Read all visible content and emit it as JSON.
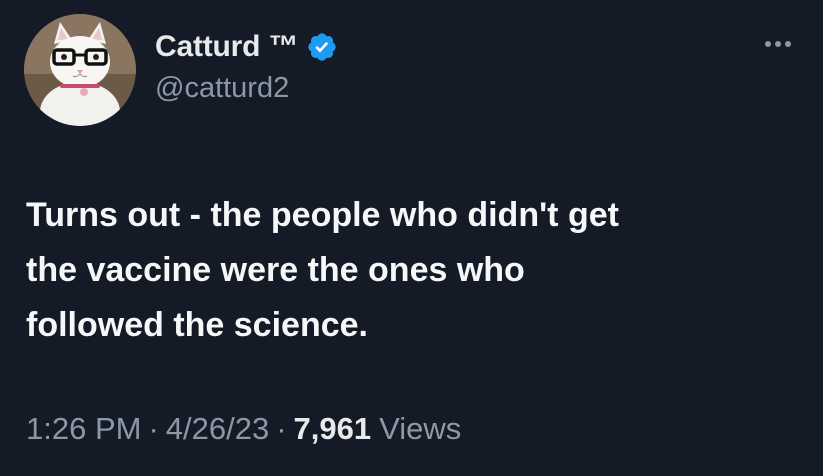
{
  "author": {
    "display_name": "Catturd ™",
    "handle": "@catturd2",
    "avatar_icon": "cat-with-glasses-avatar",
    "verified_icon": "verified-badge-icon",
    "verified_color": "#1d9bf0"
  },
  "more_icon": "more-horizontal-icon",
  "tweet": {
    "text": "Turns out - the people who didn't get\nthe vaccine were the ones who\nfollowed the science."
  },
  "meta": {
    "time": "1:26 PM",
    "separator": "·",
    "date": "4/26/23",
    "views_count": "7,961",
    "views_label": "Views"
  },
  "colors": {
    "background": "#151b26",
    "text_primary": "#e7e9ea",
    "text_secondary": "#8b98a5"
  }
}
